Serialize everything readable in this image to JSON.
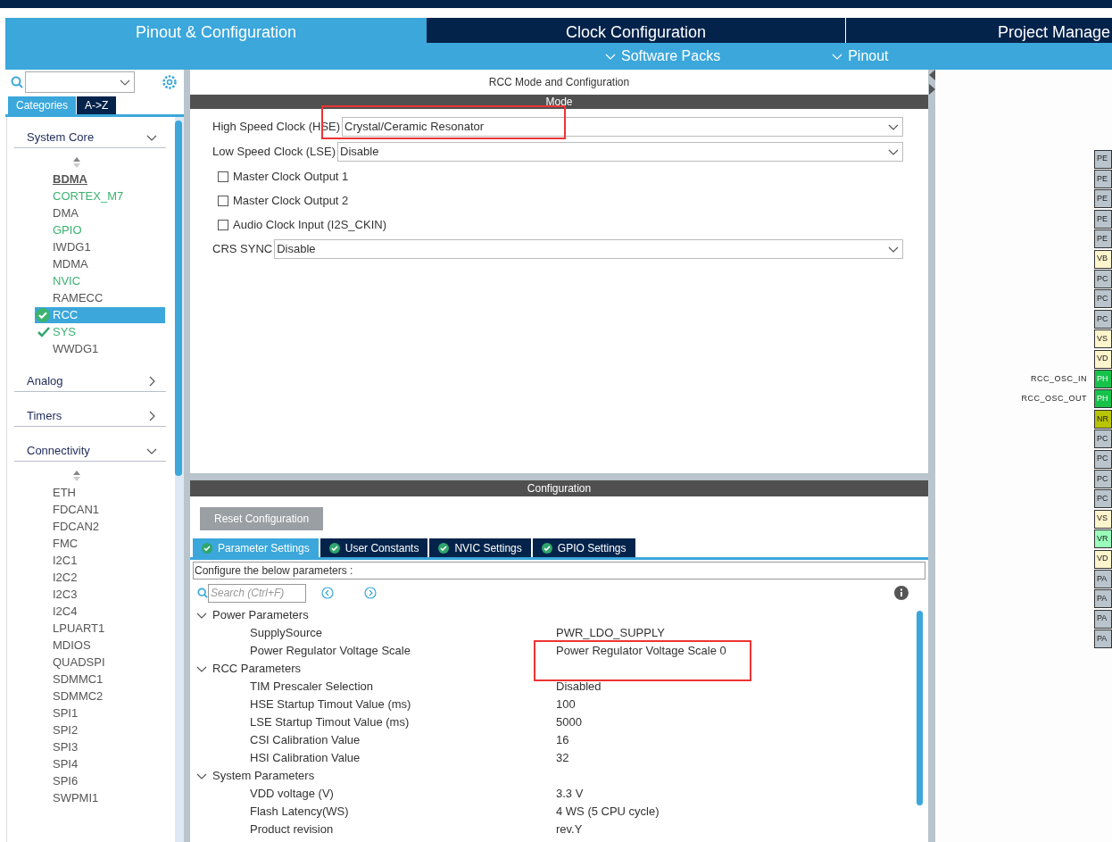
{
  "main_tabs": [
    {
      "label": "Pinout & Configuration",
      "selected": true
    },
    {
      "label": "Clock Configuration",
      "selected": false
    },
    {
      "label": "Project Manage",
      "selected": false
    }
  ],
  "sub_menus": [
    "Software Packs",
    "Pinout"
  ],
  "sidebar": {
    "view_tabs": [
      {
        "label": "Categories",
        "selected": true
      },
      {
        "label": "A->Z",
        "selected": false
      }
    ],
    "categories": [
      {
        "label": "System Core",
        "expanded": true,
        "items": [
          {
            "label": "BDMA",
            "color": "#555555",
            "hovered": true,
            "selected": false,
            "checked": false
          },
          {
            "label": "CORTEX_M7",
            "color": "#3cb371",
            "hovered": false,
            "selected": false,
            "checked": false
          },
          {
            "label": "DMA",
            "color": "#555555",
            "hovered": false,
            "selected": false,
            "checked": false
          },
          {
            "label": "GPIO",
            "color": "#3cb371",
            "hovered": false,
            "selected": false,
            "checked": false
          },
          {
            "label": "IWDG1",
            "color": "#555555",
            "hovered": false,
            "selected": false,
            "checked": false
          },
          {
            "label": "MDMA",
            "color": "#555555",
            "hovered": false,
            "selected": false,
            "checked": false
          },
          {
            "label": "NVIC",
            "color": "#3cb371",
            "hovered": false,
            "selected": false,
            "checked": false
          },
          {
            "label": "RAMECC",
            "color": "#555555",
            "hovered": false,
            "selected": false,
            "checked": false
          },
          {
            "label": "RCC",
            "color": "#3cb371",
            "hovered": false,
            "selected": true,
            "checked": true
          },
          {
            "label": "SYS",
            "color": "#3cb371",
            "hovered": false,
            "selected": false,
            "checked": true
          },
          {
            "label": "WWDG1",
            "color": "#555555",
            "hovered": false,
            "selected": false,
            "checked": false
          }
        ]
      },
      {
        "label": "Analog",
        "expanded": false
      },
      {
        "label": "Timers",
        "expanded": false
      },
      {
        "label": "Connectivity",
        "expanded": true,
        "items": [
          {
            "label": "ETH",
            "color": "#555555",
            "hovered": false,
            "selected": false,
            "checked": false
          },
          {
            "label": "FDCAN1",
            "color": "#555555",
            "hovered": false,
            "selected": false,
            "checked": false
          },
          {
            "label": "FDCAN2",
            "color": "#555555",
            "hovered": false,
            "selected": false,
            "checked": false
          },
          {
            "label": "FMC",
            "color": "#555555",
            "hovered": false,
            "selected": false,
            "checked": false
          },
          {
            "label": "I2C1",
            "color": "#555555",
            "hovered": false,
            "selected": false,
            "checked": false
          },
          {
            "label": "I2C2",
            "color": "#555555",
            "hovered": false,
            "selected": false,
            "checked": false
          },
          {
            "label": "I2C3",
            "color": "#555555",
            "hovered": false,
            "selected": false,
            "checked": false
          },
          {
            "label": "I2C4",
            "color": "#555555",
            "hovered": false,
            "selected": false,
            "checked": false
          },
          {
            "label": "LPUART1",
            "color": "#555555",
            "hovered": false,
            "selected": false,
            "checked": false
          },
          {
            "label": "MDIOS",
            "color": "#555555",
            "hovered": false,
            "selected": false,
            "checked": false
          },
          {
            "label": "QUADSPI",
            "color": "#555555",
            "hovered": false,
            "selected": false,
            "checked": false
          },
          {
            "label": "SDMMC1",
            "color": "#555555",
            "hovered": false,
            "selected": false,
            "checked": false
          },
          {
            "label": "SDMMC2",
            "color": "#555555",
            "hovered": false,
            "selected": false,
            "checked": false
          },
          {
            "label": "SPI1",
            "color": "#555555",
            "hovered": false,
            "selected": false,
            "checked": false
          },
          {
            "label": "SPI2",
            "color": "#555555",
            "hovered": false,
            "selected": false,
            "checked": false
          },
          {
            "label": "SPI3",
            "color": "#555555",
            "hovered": false,
            "selected": false,
            "checked": false
          },
          {
            "label": "SPI4",
            "color": "#555555",
            "hovered": false,
            "selected": false,
            "checked": false
          },
          {
            "label": "SPI6",
            "color": "#555555",
            "hovered": false,
            "selected": false,
            "checked": false
          },
          {
            "label": "SWPMI1",
            "color": "#555555",
            "hovered": false,
            "selected": false,
            "checked": false
          }
        ]
      }
    ]
  },
  "panel_title": "RCC Mode and Configuration",
  "mode": {
    "header": "Mode",
    "fields": [
      {
        "kind": "select",
        "label": "High Speed Clock (HSE)",
        "value": "Crystal/Ceramic Resonator",
        "highlighted": true
      },
      {
        "kind": "select",
        "label": "Low Speed Clock (LSE)",
        "value": "Disable",
        "highlighted": false
      },
      {
        "kind": "checkbox",
        "label": "Master Clock Output 1",
        "checked": false
      },
      {
        "kind": "checkbox",
        "label": "Master Clock Output 2",
        "checked": false
      },
      {
        "kind": "checkbox",
        "label": "Audio Clock Input (I2S_CKIN)",
        "checked": false
      },
      {
        "kind": "select",
        "label": "CRS SYNC",
        "value": "Disable",
        "highlighted": false
      }
    ]
  },
  "configuration": {
    "header": "Configuration",
    "reset_button": "Reset Configuration",
    "tabs": [
      {
        "label": "Parameter Settings",
        "selected": true
      },
      {
        "label": "User Constants",
        "selected": false
      },
      {
        "label": "NVIC Settings",
        "selected": false
      },
      {
        "label": "GPIO Settings",
        "selected": false
      }
    ],
    "hint": "Configure the below parameters :",
    "search": {
      "placeholder": "Search (Ctrl+F)"
    },
    "groups": [
      {
        "label": "Power Parameters",
        "expanded": true,
        "children": [
          {
            "name": "SupplySource",
            "value": "PWR_LDO_SUPPLY",
            "highlighted": false
          },
          {
            "name": "Power Regulator Voltage Scale",
            "value": "Power Regulator Voltage Scale 0",
            "highlighted": true
          }
        ]
      },
      {
        "label": "RCC Parameters",
        "expanded": true,
        "children": [
          {
            "name": "TIM Prescaler Selection",
            "value": "Disabled",
            "highlighted": false
          },
          {
            "name": "HSE Startup Timout Value (ms)",
            "value": "100",
            "highlighted": false
          },
          {
            "name": "LSE Startup Timout Value (ms)",
            "value": "5000",
            "highlighted": false
          },
          {
            "name": "CSI Calibration Value",
            "value": "16",
            "highlighted": false
          },
          {
            "name": "HSI Calibration Value",
            "value": "32",
            "highlighted": false
          }
        ]
      },
      {
        "label": "System Parameters",
        "expanded": true,
        "children": [
          {
            "name": "VDD voltage (V)",
            "value": "3.3 V",
            "highlighted": false
          },
          {
            "name": "Flash Latency(WS)",
            "value": "4 WS (5 CPU cycle)",
            "highlighted": false
          },
          {
            "name": "Product revision",
            "value": "rev.Y",
            "highlighted": false
          }
        ]
      }
    ]
  },
  "pins": [
    {
      "label": "PE",
      "color": "#b9c4cc"
    },
    {
      "label": "PE",
      "color": "#b9c4cc"
    },
    {
      "label": "PE",
      "color": "#b9c4cc"
    },
    {
      "label": "PE",
      "color": "#b9c4cc"
    },
    {
      "label": "PE",
      "color": "#b9c4cc"
    },
    {
      "label": "VB",
      "color": "#fff5cc"
    },
    {
      "label": "PC",
      "color": "#b9c4cc"
    },
    {
      "label": "PC",
      "color": "#b9c4cc"
    },
    {
      "label": "PC",
      "color": "#b9c4cc"
    },
    {
      "label": "VS",
      "color": "#fff5cc"
    },
    {
      "label": "VD",
      "color": "#fff5cc"
    },
    {
      "label": "PH",
      "color": "#17c24b",
      "signal": "RCC_OSC_IN"
    },
    {
      "label": "PH",
      "color": "#17c24b",
      "signal": "RCC_OSC_OUT"
    },
    {
      "label": "NR",
      "color": "#b8c400"
    },
    {
      "label": "PC",
      "color": "#b9c4cc"
    },
    {
      "label": "PC",
      "color": "#b9c4cc"
    },
    {
      "label": "PC",
      "color": "#b9c4cc"
    },
    {
      "label": "PC",
      "color": "#b9c4cc"
    },
    {
      "label": "VS",
      "color": "#fff5cc"
    },
    {
      "label": "VR",
      "color": "#99ffbb"
    },
    {
      "label": "VD",
      "color": "#fff5cc"
    },
    {
      "label": "PA",
      "color": "#b9c4cc"
    },
    {
      "label": "PA",
      "color": "#b9c4cc"
    },
    {
      "label": "PA",
      "color": "#b9c4cc"
    },
    {
      "label": "PA",
      "color": "#b9c4cc"
    }
  ]
}
